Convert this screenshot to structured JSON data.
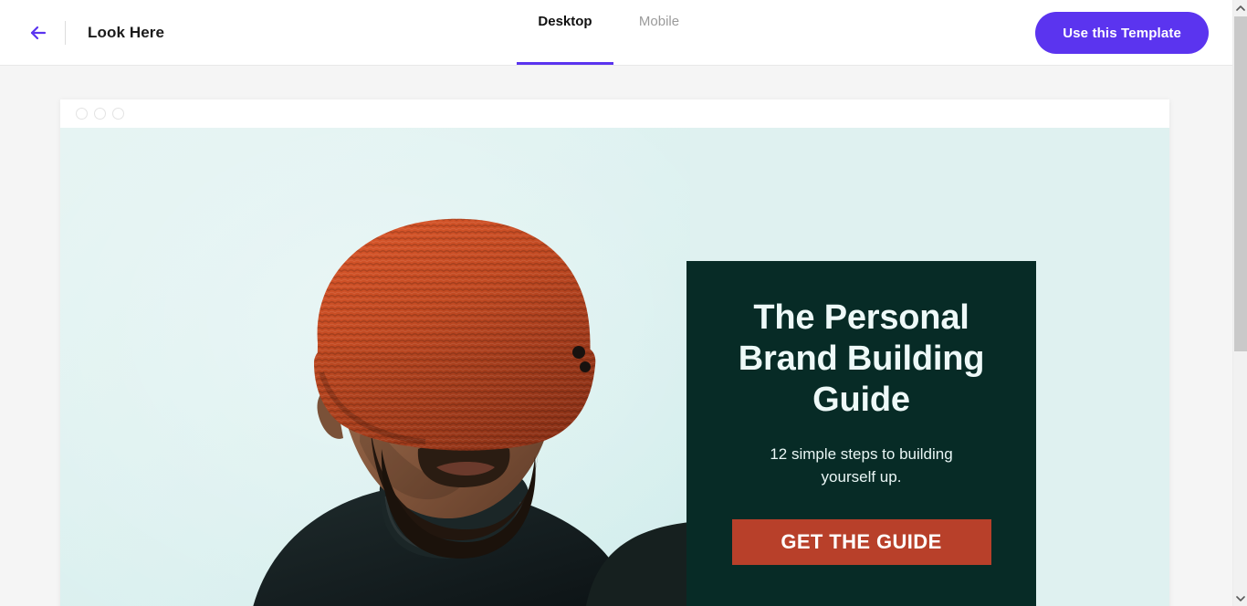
{
  "header": {
    "back_icon": "arrow-left-icon",
    "project_title": "Look Here",
    "tabs": [
      {
        "label": "Desktop",
        "active": true
      },
      {
        "label": "Mobile",
        "active": false
      }
    ],
    "primary_action": "Use this Template",
    "accent_color": "#5b34ef"
  },
  "preview": {
    "browser_dots": [
      "close-dot",
      "minimize-dot",
      "maximize-dot"
    ],
    "image_alt": "Man wearing orange knit beanie and black turtleneck",
    "background_color": "#dff1f0",
    "promo": {
      "panel_color": "#072b26",
      "title": "The Personal Brand Building Guide",
      "subtitle": "12 simple steps to building yourself up.",
      "cta_label": "GET THE GUIDE",
      "cta_color": "#b8402a"
    }
  },
  "scrollbar": {
    "up_icon": "chevron-up-icon",
    "down_icon": "chevron-down-icon"
  }
}
